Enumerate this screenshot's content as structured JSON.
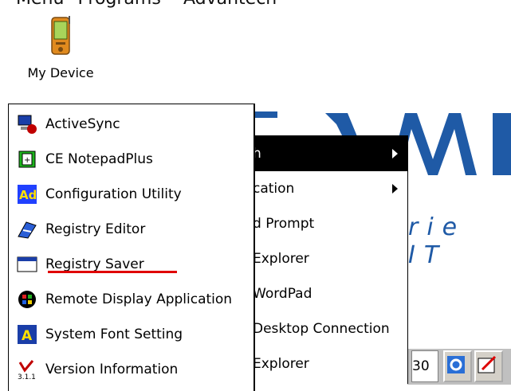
{
  "caption": "Menü \"Programs\"-\"Advantech\"",
  "desktop": {
    "icon_label": "My Device"
  },
  "logo": {
    "tagline": "rie IT"
  },
  "menu": {
    "items": [
      {
        "label": "ActiveSync",
        "icon": "activesync-icon"
      },
      {
        "label": "CE NotepadPlus",
        "icon": "notepad-icon"
      },
      {
        "label": "Configuration Utility",
        "icon": "config-utility-icon"
      },
      {
        "label": "Registry Editor",
        "icon": "registry-editor-icon"
      },
      {
        "label": "Registry Saver",
        "icon": "registry-saver-icon"
      },
      {
        "label": "Remote Display Application",
        "icon": "remote-display-icon"
      },
      {
        "label": "System Font Setting",
        "icon": "font-setting-icon"
      },
      {
        "label": "Version Information",
        "icon": "version-info-icon"
      }
    ]
  },
  "submenu": {
    "items": [
      {
        "label": "h"
      },
      {
        "label": "cation"
      },
      {
        "label": "d Prompt"
      },
      {
        "label": "Explorer"
      },
      {
        "label": "WordPad"
      },
      {
        "label": "Desktop Connection"
      },
      {
        "label": "Explorer"
      }
    ]
  },
  "taskbar": {
    "clock": "30"
  },
  "colors": {
    "highlight": "#000000",
    "underline": "#e00000",
    "logo_blue": "#1f5aa6"
  }
}
